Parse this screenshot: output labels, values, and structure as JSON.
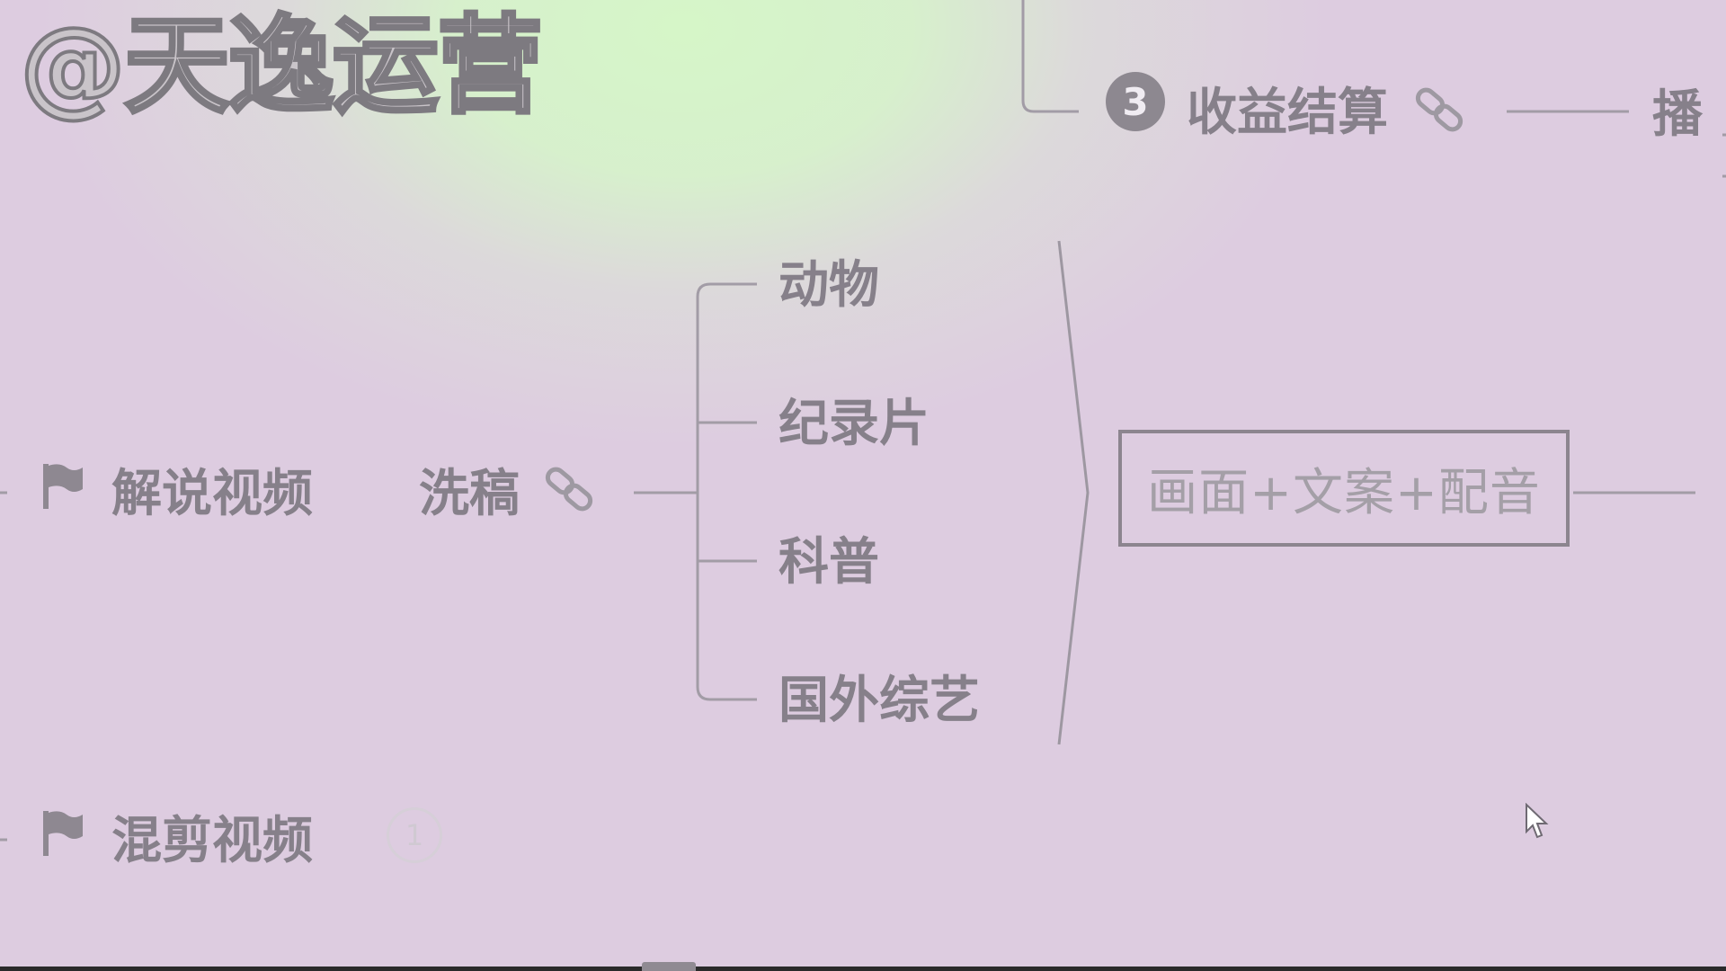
{
  "watermark": "@天逸运营",
  "mindmap": {
    "top_branch": {
      "badge": "3",
      "label": "收益结算",
      "next_label": "播"
    },
    "main_topic": "解说视频",
    "subtopic": "洗稿",
    "categories": [
      "动物",
      "纪录片",
      "科普",
      "国外综艺"
    ],
    "summary": "画面+文案+配音",
    "sibling_topic": "混剪视频",
    "sibling_badge": "1"
  },
  "colors": {
    "text": "#86808a",
    "line": "#a29ca6",
    "background": "#ddcce0",
    "highlight": "#d6f6c8"
  },
  "icons": [
    "flag-icon",
    "link-icon",
    "cursor-icon"
  ]
}
